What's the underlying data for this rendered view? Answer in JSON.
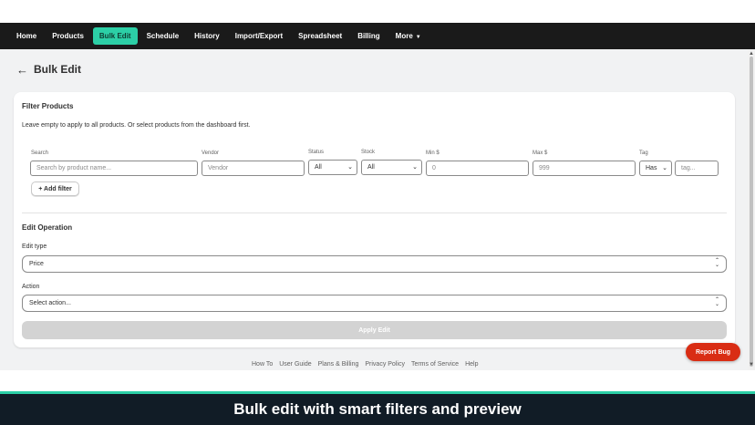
{
  "nav": {
    "items": [
      {
        "label": "Home"
      },
      {
        "label": "Products"
      },
      {
        "label": "Bulk Edit"
      },
      {
        "label": "Schedule"
      },
      {
        "label": "History"
      },
      {
        "label": "Import/Export"
      },
      {
        "label": "Spreadsheet"
      },
      {
        "label": "Billing"
      },
      {
        "label": "More"
      }
    ],
    "active": "Bulk Edit",
    "accent_color": "#2ccfa6"
  },
  "page": {
    "title": "Bulk Edit"
  },
  "filter": {
    "title": "Filter Products",
    "help": "Leave empty to apply to all products. Or select products from the dashboard first.",
    "search": {
      "label": "Search",
      "placeholder": "Search by product name..."
    },
    "vendor": {
      "label": "Vendor",
      "placeholder": "Vendor"
    },
    "status": {
      "label": "Status",
      "value": "All"
    },
    "stock": {
      "label": "Stock",
      "value": "All"
    },
    "min": {
      "label": "Min $",
      "placeholder": "0"
    },
    "max": {
      "label": "Max $",
      "placeholder": "999"
    },
    "tag": {
      "label": "Tag",
      "mode": "Has",
      "placeholder": "tag..."
    },
    "add_filter": "+ Add filter"
  },
  "edit": {
    "title": "Edit Operation",
    "type_label": "Edit type",
    "type_value": "Price",
    "action_label": "Action",
    "action_value": "Select action...",
    "apply": "Apply Edit"
  },
  "footer": {
    "links": [
      "How To",
      "User Guide",
      "Plans & Billing",
      "Privacy Policy",
      "Terms of Service",
      "Help"
    ]
  },
  "report_bug": "Report Bug",
  "caption": "Bulk edit with smart filters and preview"
}
